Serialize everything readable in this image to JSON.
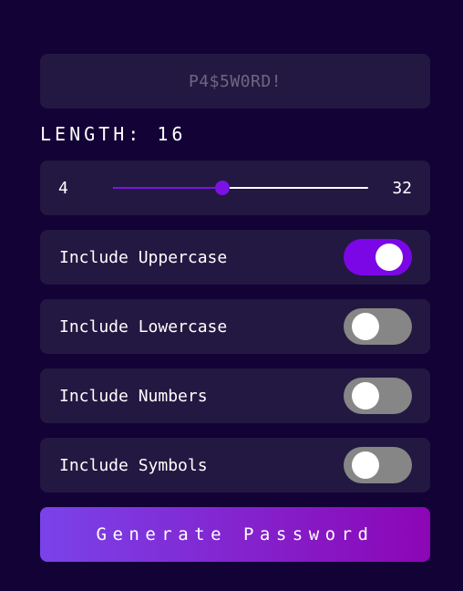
{
  "output": {
    "password_placeholder": "P4$5W0RD!"
  },
  "length": {
    "label": "LENGTH: 16",
    "value": 16
  },
  "slider": {
    "min_label": "4",
    "max_label": "32",
    "min": 4,
    "max": 32,
    "value": 16
  },
  "options": [
    {
      "label": "Include Uppercase",
      "enabled": true
    },
    {
      "label": "Include Lowercase",
      "enabled": false
    },
    {
      "label": "Include Numbers",
      "enabled": false
    },
    {
      "label": "Include Symbols",
      "enabled": false
    }
  ],
  "generate_button": {
    "label": "Generate Password"
  },
  "colors": {
    "background": "#130236",
    "panel": "#231841",
    "accent": "#7b12e3",
    "toggle_off": "#868686"
  }
}
